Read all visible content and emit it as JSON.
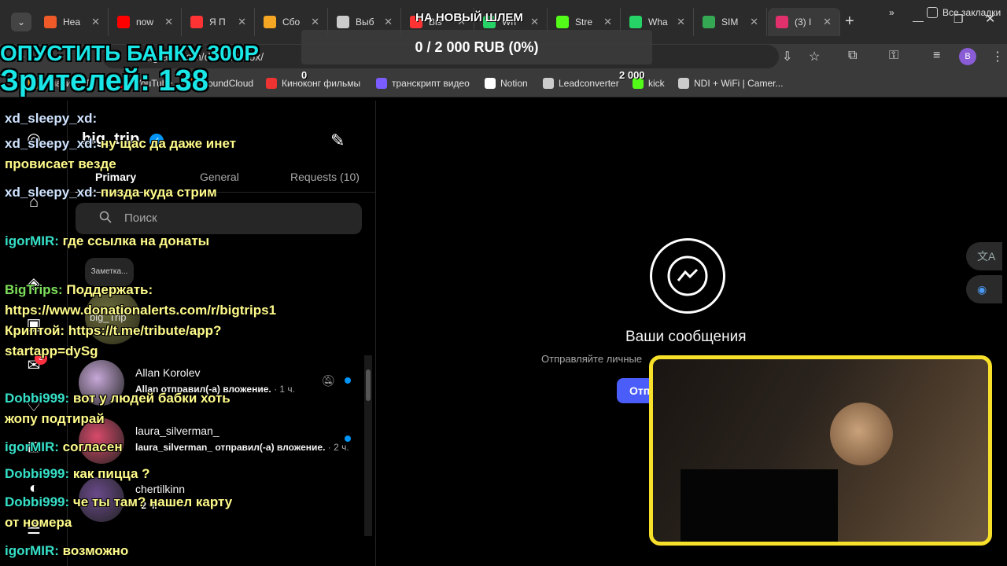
{
  "browser": {
    "tabs": [
      {
        "label": "Hea",
        "color": "#f05a28"
      },
      {
        "label": "now",
        "color": "#ff0000"
      },
      {
        "label": "Я П",
        "color": "#ff3333"
      },
      {
        "label": "Сбо",
        "color": "#f5a623"
      },
      {
        "label": "Выб",
        "color": "#cccccc"
      },
      {
        "label": "Bis",
        "color": "#ff3333"
      },
      {
        "label": "Wh",
        "color": "#25d366"
      },
      {
        "label": "Stre",
        "color": "#53fc18"
      },
      {
        "label": "Wha",
        "color": "#25d366"
      },
      {
        "label": "SIM",
        "color": "#34a853"
      },
      {
        "label": "(3) I",
        "color": "#e1306c"
      }
    ],
    "new_tab_label": "+",
    "url": "instagram.com/direct/inbox/",
    "profile_initial": "B",
    "bookmarks": [
      {
        "label": "Спасибо Те",
        "color": "#f5a623"
      },
      {
        "label": "YouTube",
        "color": "#ff0000"
      },
      {
        "label": "SoundCloud",
        "color": "#ff5500"
      },
      {
        "label": "Киноконг фильмы",
        "color": "#e33"
      },
      {
        "label": "транскрипт видео",
        "color": "#7b5cff"
      },
      {
        "label": "Notion",
        "color": "#ffffff"
      },
      {
        "label": "Leadconverter",
        "color": "#cccccc"
      },
      {
        "label": "kick",
        "color": "#53fc18"
      },
      {
        "label": "NDI + WiFi | Camer...",
        "color": "#cccccc"
      }
    ],
    "all_bookmarks": "Все закладки",
    "more_bookmarks": "»"
  },
  "instagram": {
    "username": "big_trip",
    "tabs": [
      {
        "label": "Primary",
        "selected": true
      },
      {
        "label": "General",
        "selected": false
      },
      {
        "label": "Requests (10)",
        "selected": false
      }
    ],
    "search_placeholder": "Поиск",
    "note_label": "Заметка...",
    "note_name": "big_Trip",
    "conversations": [
      {
        "name": "Allan Korolev",
        "message": "Allan отправил(-а) вложение.",
        "time": "· 1 ч.",
        "unread": true,
        "muted": true,
        "color": "#c7a8d8"
      },
      {
        "name": "laura_silverman_",
        "message": "laura_silverman_ отправил(-а) вложение.",
        "time": "· 2 ч.",
        "unread": true,
        "muted": false,
        "color": "#d84a6a"
      },
      {
        "name": "chertilkinn",
        "message": "· 2 ч.",
        "time": "",
        "unread": false,
        "muted": false,
        "color": "#6a4a8a"
      }
    ],
    "empty_title": "Ваши сообщения",
    "empty_subtitle": "Отправляйте личные",
    "send_button": "Отп",
    "nav_notification_count": "3"
  },
  "overlay": {
    "donation_banner": "ОПУСТИТЬ БАНКУ 300Р",
    "viewers_label": "Зрителей: 138",
    "goal": {
      "title": "НА НОВЫЙ ШЛЕМ",
      "progress_text": "0 / 2 000 RUB (0%)",
      "progress": 0,
      "min_label": "0",
      "max_label": "2 000"
    },
    "chat": [
      {
        "user": "xd_sleepy_xd:",
        "text": "",
        "user_color": "#cfe3ff"
      },
      {
        "user": "xd_sleepy_xd:",
        "text": "ну щас да даже инет провисает везде",
        "user_color": "#cfe3ff"
      },
      {
        "user": "xd_sleepy_xd:",
        "text": "пизда куда стрим",
        "user_color": "#cfe3ff"
      },
      {
        "user": "igorMIR:",
        "text": "где ссылка на донаты",
        "user_color": "#36e0c8"
      },
      {
        "user": "BigTrips:",
        "text": "Поддержать: https://www.donationalerts.com/r/bigtrips1 Криптой: https://t.me/tribute/app?startapp=dySg",
        "user_color": "#7ee05a"
      },
      {
        "user": "Dobbi999:",
        "text": "вот у людей бабки хоть жопу подтирай",
        "user_color": "#36e0c8"
      },
      {
        "user": "igorMIR:",
        "text": "согласен",
        "user_color": "#36e0c8"
      },
      {
        "user": "Dobbi999:",
        "text": "как пицца ?",
        "user_color": "#36e0c8"
      },
      {
        "user": "Dobbi999:",
        "text": "че ты там? нашел карту от номера",
        "user_color": "#36e0c8"
      },
      {
        "user": "igorMIR:",
        "text": "возможно",
        "user_color": "#36e0c8"
      }
    ]
  }
}
